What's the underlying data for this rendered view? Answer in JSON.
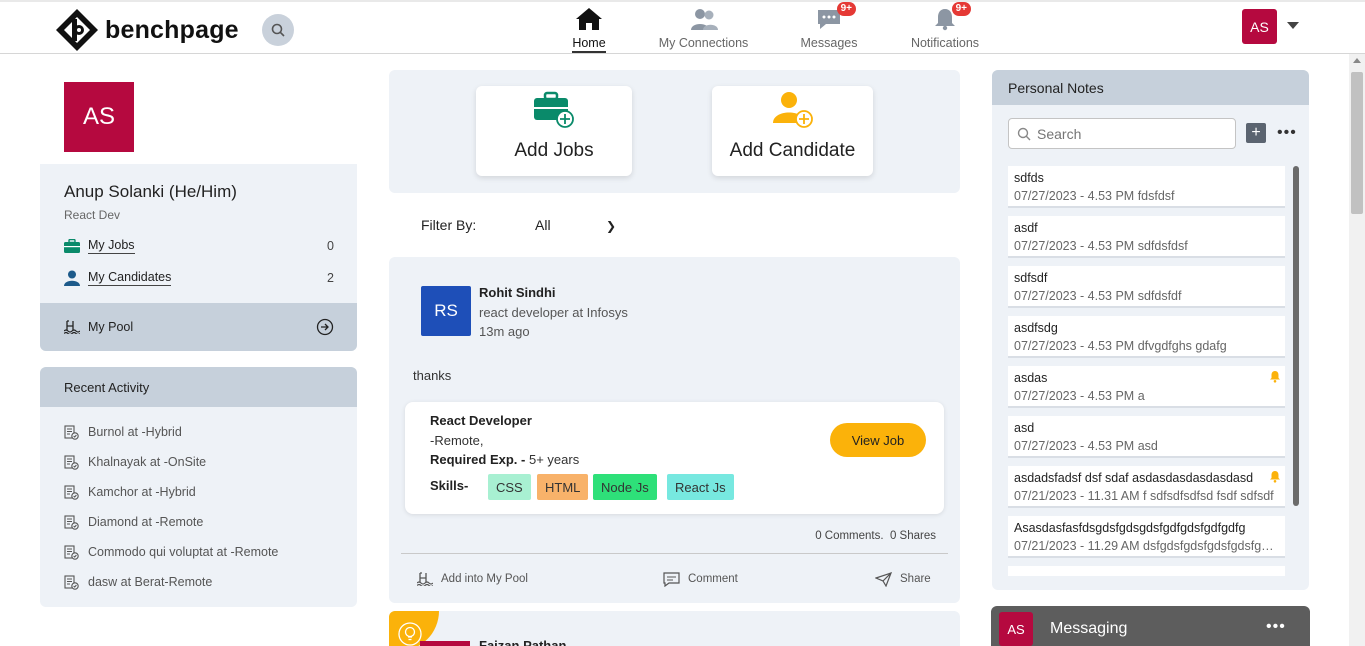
{
  "header": {
    "logo_text": "benchpage",
    "nav": [
      {
        "label": "Home",
        "active": true
      },
      {
        "label": "My Connections",
        "active": false
      },
      {
        "label": "Messages",
        "badge": "9+"
      },
      {
        "label": "Notifications",
        "badge": "9+"
      }
    ],
    "user_initials": "AS"
  },
  "profile": {
    "initials": "AS",
    "name": "Anup Solanki (He/Him)",
    "role": "React Dev",
    "stats": [
      {
        "label": "My Jobs",
        "count": "0",
        "icon": "briefcase-icon"
      },
      {
        "label": "My Candidates",
        "count": "2",
        "icon": "person-icon"
      }
    ],
    "pool_label": "My Pool"
  },
  "recent_activity": {
    "title": "Recent Activity",
    "items": [
      "Burnol at -Hybrid",
      "Khalnayak at -OnSite",
      "Kamchor at -Hybrid",
      "Diamond at -Remote",
      "Commodo qui voluptat at -Remote",
      "dasw at Berat-Remote"
    ]
  },
  "actions": {
    "add_jobs": "Add Jobs",
    "add_candidate": "Add Candidate"
  },
  "filter": {
    "label": "Filter By:",
    "value": "All"
  },
  "post": {
    "initials": "RS",
    "author": "Rohit Sindhi",
    "headline": "react developer at Infosys",
    "time": "13m ago",
    "text": "thanks",
    "job": {
      "title": "React Developer",
      "location": "-Remote,",
      "exp_label": "Required Exp. -",
      "exp_value": "5+ years",
      "skills_label": "Skills-",
      "skills": [
        {
          "name": "CSS",
          "color": "#a8f0d2"
        },
        {
          "name": "HTML",
          "color": "#f8b26a"
        },
        {
          "name": "Node Js",
          "color": "#2ee079"
        },
        {
          "name": "React Js",
          "color": "#77e8e0"
        }
      ],
      "view_label": "View Job"
    },
    "comments": "0 Comments.",
    "shares": "0 Shares",
    "act_pool": "Add into My Pool",
    "act_comment": "Comment",
    "act_share": "Share"
  },
  "post2": {
    "author": "Faizan Pathan"
  },
  "notes": {
    "title": "Personal Notes",
    "search_placeholder": "Search",
    "items": [
      {
        "title": "sdfds",
        "meta": "07/27/2023 - 4.53 PM fdsfdsf",
        "bell": false
      },
      {
        "title": "asdf",
        "meta": "07/27/2023 - 4.53 PM sdfdsfdsf",
        "bell": false
      },
      {
        "title": "sdfsdf",
        "meta": "07/27/2023 - 4.53 PM sdfdsfdf",
        "bell": false
      },
      {
        "title": "asdfsdg",
        "meta": "07/27/2023 - 4.53 PM dfvgdfghs gdafg",
        "bell": false
      },
      {
        "title": "asdas",
        "meta": "07/27/2023 - 4.53 PM a",
        "bell": true
      },
      {
        "title": "asd",
        "meta": "07/27/2023 - 4.53 PM asd",
        "bell": false
      },
      {
        "title": "asdadsfadsf dsf sdaf asdasdasdasdasdasd",
        "meta": "07/21/2023 - 11.31 AM f sdfsdfsdfsd fsdf sdfsdf",
        "bell": true
      },
      {
        "title": "Asasdasfasfdsgdsfgdsgdsfgdfgdsfgdfgdfg",
        "meta": "07/21/2023 - 11.29 AM dsfgdsfgdsfgdsfgdsfgdsfg",
        "bell": false
      }
    ]
  },
  "messaging": {
    "initials": "AS",
    "label": "Messaging"
  },
  "colors": {
    "brand": "#b5093f",
    "accent": "#fbb20a",
    "panel": "#eef2f7",
    "panel_header": "#c6d0db"
  }
}
